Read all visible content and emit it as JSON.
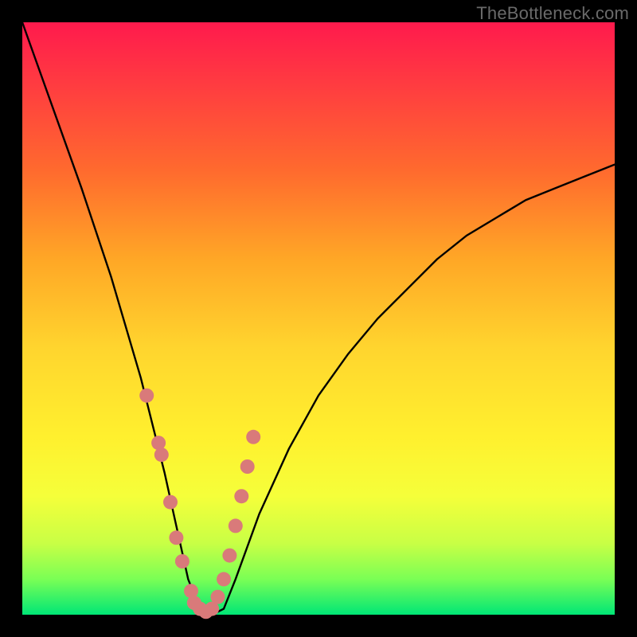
{
  "watermark": "TheBottleneck.com",
  "chart_data": {
    "type": "line",
    "title": "",
    "xlabel": "",
    "ylabel": "",
    "xlim": [
      0,
      100
    ],
    "ylim": [
      0,
      100
    ],
    "grid": false,
    "legend": false,
    "series": [
      {
        "name": "bottleneck-curve",
        "x": [
          0,
          5,
          10,
          15,
          20,
          24,
          26,
          28,
          30,
          32,
          34,
          36,
          40,
          45,
          50,
          55,
          60,
          65,
          70,
          75,
          80,
          85,
          90,
          95,
          100
        ],
        "y": [
          100,
          86,
          72,
          57,
          40,
          24,
          15,
          6,
          1,
          0,
          1,
          6,
          17,
          28,
          37,
          44,
          50,
          55,
          60,
          64,
          67,
          70,
          72,
          74,
          76
        ]
      }
    ],
    "highlight_points": {
      "name": "sample-points",
      "x": [
        21,
        23,
        23.5,
        25,
        26,
        27,
        28.5,
        29,
        30,
        31,
        32,
        33,
        34,
        35,
        36,
        37,
        38,
        39
      ],
      "y": [
        37,
        29,
        27,
        19,
        13,
        9,
        4,
        2,
        1,
        0.5,
        1,
        3,
        6,
        10,
        15,
        20,
        25,
        30
      ]
    },
    "gradient_stops": [
      {
        "pos": 0,
        "color": "#ff1a4d"
      },
      {
        "pos": 25,
        "color": "#ff6a2e"
      },
      {
        "pos": 55,
        "color": "#ffd52e"
      },
      {
        "pos": 80,
        "color": "#f5ff3a"
      },
      {
        "pos": 100,
        "color": "#00e676"
      }
    ]
  }
}
